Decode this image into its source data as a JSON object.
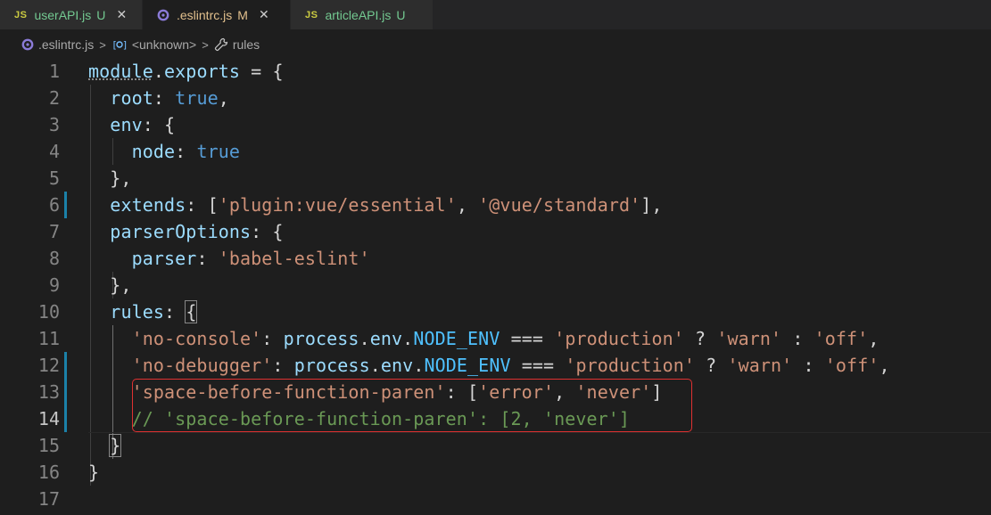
{
  "tabs": [
    {
      "icon": "JS",
      "name": "userAPI.js",
      "status": "U",
      "closable": true
    },
    {
      "icon": "gear",
      "name": ".eslintrc.js",
      "status": "M",
      "closable": true,
      "active": true
    },
    {
      "icon": "JS",
      "name": "articleAPI.js",
      "status": "U",
      "closable": false
    }
  ],
  "breadcrumb": [
    {
      "label": ".eslintrc.js"
    },
    {
      "label": "<unknown>"
    },
    {
      "label": "rules"
    }
  ],
  "editor": {
    "line_numbers": [
      "1",
      "2",
      "3",
      "4",
      "5",
      "6",
      "7",
      "8",
      "9",
      "10",
      "11",
      "12",
      "13",
      "14",
      "15",
      "16",
      "17"
    ],
    "active_line": "14",
    "lines": [
      "module.exports = {",
      "  root: true,",
      "  env: {",
      "    node: true",
      "  },",
      "  extends: ['plugin:vue/essential', '@vue/standard'],",
      "  parserOptions: {",
      "    parser: 'babel-eslint'",
      "  },",
      "  rules: {",
      "    'no-console': process.env.NODE_ENV === 'production' ? 'warn' : 'off',",
      "    'no-debugger': process.env.NODE_ENV === 'production' ? 'warn' : 'off',",
      "    'space-before-function-paren': ['error', 'never']",
      "    // 'space-before-function-paren': [2, 'never']",
      "  }",
      "}",
      ""
    ]
  },
  "colors": {
    "background": "#1e1e1e",
    "property": "#9cdcfe",
    "keyword": "#569cd6",
    "string": "#ce9178",
    "comment": "#6a9955",
    "highlight_border": "#e03131",
    "git_modified": "#1b81a8"
  }
}
